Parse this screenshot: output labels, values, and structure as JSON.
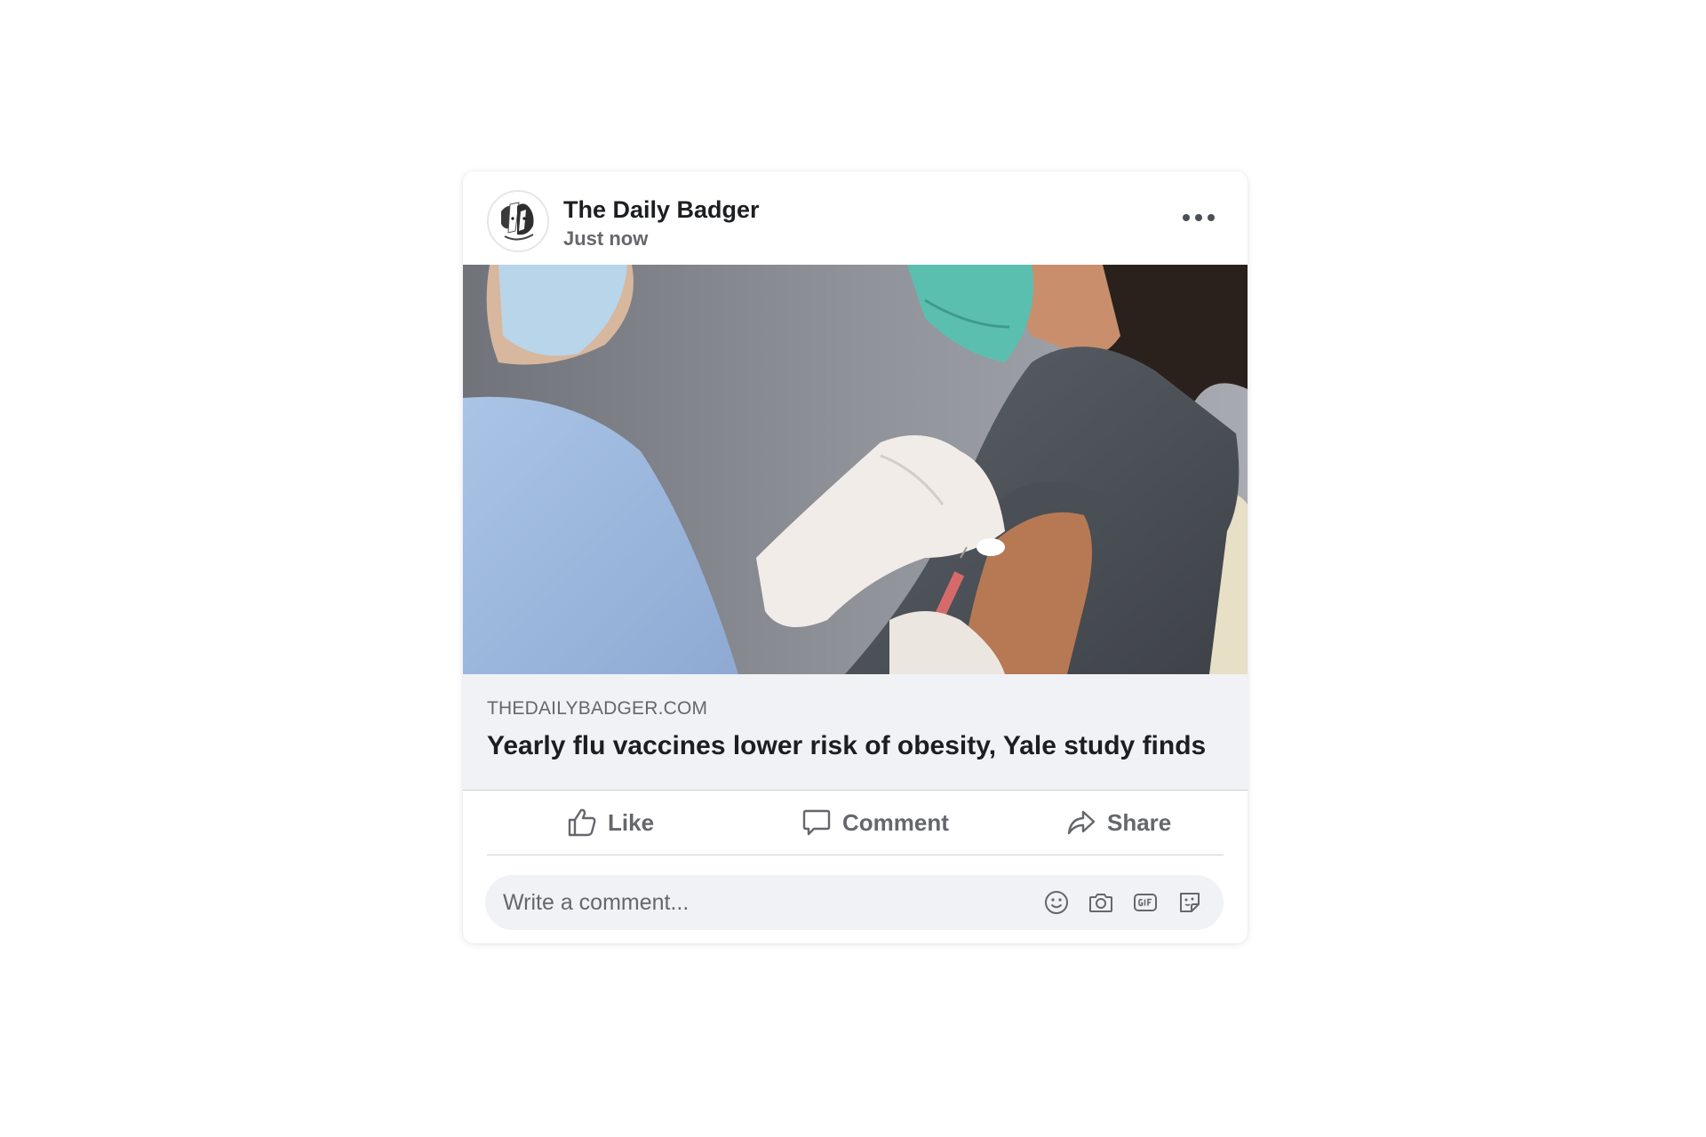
{
  "post": {
    "page_name": "The Daily Badger",
    "timestamp": "Just now",
    "avatar_icon": "badger-logo",
    "more_icon": "more-options-icon"
  },
  "link_preview": {
    "domain": "THEDAILYBADGER.COM",
    "title": "Yearly flu vaccines lower risk of obesity, Yale study finds",
    "image_description_icon": "vaccination-photo"
  },
  "actions": {
    "like_label": "Like",
    "comment_label": "Comment",
    "share_label": "Share"
  },
  "comment_box": {
    "placeholder": "Write a comment...",
    "tools": [
      "emoji-icon",
      "camera-icon",
      "gif-icon",
      "sticker-icon"
    ]
  },
  "colors": {
    "primary_text": "#1c1e21",
    "secondary_text": "#65676b",
    "preview_background": "#f0f2f5",
    "divider": "#ced0d4"
  }
}
